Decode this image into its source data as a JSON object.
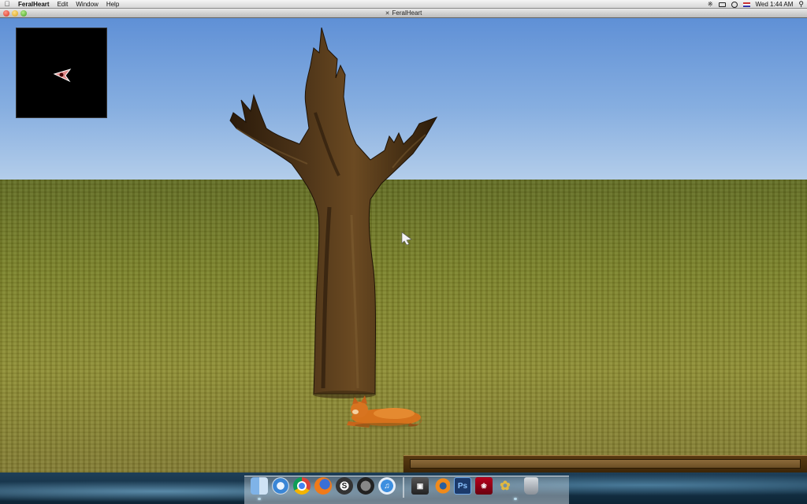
{
  "menubar": {
    "app_name": "FeralHeart",
    "menus": [
      "Edit",
      "Window",
      "Help"
    ],
    "clock": "Wed 1:44 AM",
    "status_icons": [
      "bluetooth-icon",
      "display-icon",
      "time-machine-icon",
      "flag-icon",
      "spotlight-icon"
    ]
  },
  "window": {
    "title": "FeralHeart"
  },
  "scene": {
    "sky_color": "#86aee0",
    "ground_color": "#7d8030",
    "objects": [
      "dead-tree",
      "orange-cat-character",
      "mouse-cursor"
    ]
  },
  "minimap": {
    "player_marker_color": "#e08a8a"
  },
  "dock": {
    "apps": [
      "Finder",
      "Safari",
      "Google Chrome",
      "Firefox",
      "Skype",
      "QuickTime Player",
      "iTunes",
      "Tool",
      "Blender",
      "Photoshop",
      "Rose",
      "FeralHeart",
      "Trash"
    ]
  }
}
